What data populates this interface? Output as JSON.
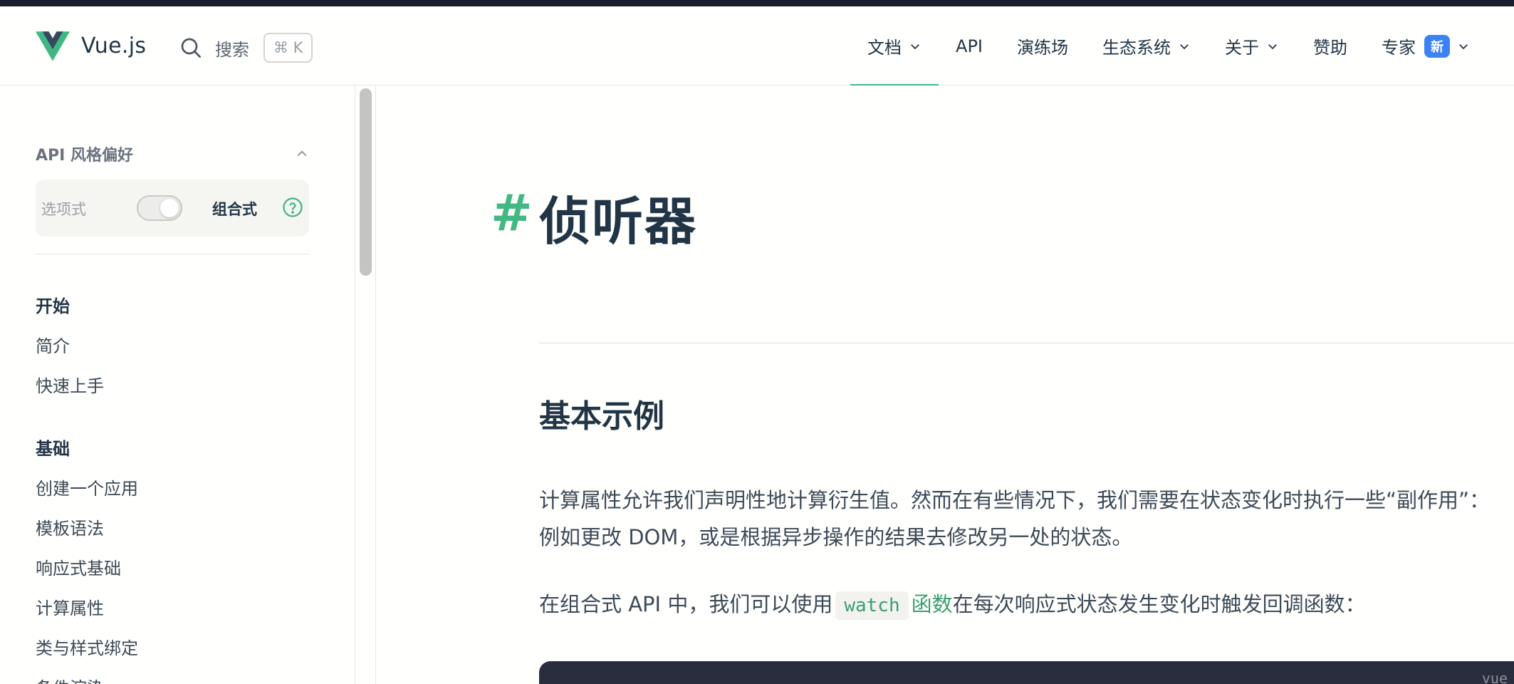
{
  "header": {
    "brand": "Vue.js",
    "search_label": "搜索",
    "search_shortcut": "⌘ K",
    "nav": [
      {
        "label": "文档",
        "has_dropdown": true,
        "active": true
      },
      {
        "label": "API",
        "has_dropdown": false
      },
      {
        "label": "演练场",
        "has_dropdown": false
      },
      {
        "label": "生态系统",
        "has_dropdown": true
      },
      {
        "label": "关于",
        "has_dropdown": true
      },
      {
        "label": "赞助",
        "has_dropdown": false
      },
      {
        "label": "专家",
        "has_dropdown": true,
        "badge": "新"
      }
    ]
  },
  "sidebar": {
    "api_pref": {
      "title": "API 风格偏好",
      "option_left": "选项式",
      "option_right": "组合式",
      "selected": "组合式"
    },
    "groups": [
      {
        "title": "开始",
        "items": [
          "简介",
          "快速上手"
        ]
      },
      {
        "title": "基础",
        "items": [
          "创建一个应用",
          "模板语法",
          "响应式基础",
          "计算属性",
          "类与样式绑定",
          "条件渲染"
        ]
      }
    ]
  },
  "main": {
    "anchor": "#",
    "title": "侦听器",
    "section_title": "基本示例",
    "para1": "计算属性允许我们声明性地计算衍生值。然而在有些情况下，我们需要在状态变化时执行一些“副作用”：例如更改 DOM，或是根据异步操作的结果去修改另一处的状态。",
    "para2_prefix": "在组合式 API 中，我们可以使用",
    "para2_code": "watch",
    "para2_link": "函数",
    "para2_suffix": "在每次响应式状态发生变化时触发回调函数：",
    "code_lang": "vue"
  },
  "colors": {
    "brand_green": "#42b883",
    "text_dark": "#213547",
    "badge_blue": "#3b82f6",
    "code_bg": "#292d3e"
  }
}
